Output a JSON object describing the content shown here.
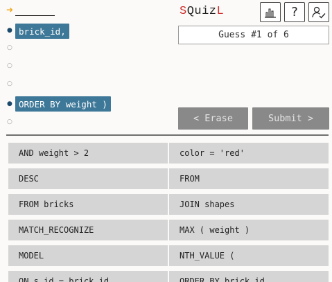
{
  "logo": {
    "prefix": "S",
    "middle": "Quiz",
    "suffix": "L"
  },
  "toolbar": {
    "stats_icon": "bar-chart-icon",
    "help_label": "?",
    "account_icon": "user-check-icon"
  },
  "guess_status": "Guess #1 of 6",
  "answer_slots": [
    {
      "text": "brick_id,",
      "filled": true
    },
    {
      "text": "",
      "filled": false
    },
    {
      "text": "",
      "filled": false
    },
    {
      "text": "",
      "filled": false
    },
    {
      "text": "ORDER BY weight )",
      "filled": true
    },
    {
      "text": "",
      "filled": false
    }
  ],
  "buttons": {
    "erase": "< Erase",
    "submit": "Submit >"
  },
  "tiles": [
    "AND weight > 2",
    "color = 'red'",
    "DESC",
    "FROM",
    "FROM bricks",
    "JOIN shapes",
    "MATCH_RECOGNIZE",
    "MAX ( weight )",
    "MODEL",
    "NTH_VALUE (",
    "ON s.id = brick_id",
    "ORDER BY brick_id"
  ],
  "colors": {
    "accent_red": "#cf2f2f",
    "chip_blue": "#3e7898",
    "arrow_orange": "#f0a81c",
    "disabled_button": "#898989",
    "tile_bg": "#d5d5d5"
  }
}
